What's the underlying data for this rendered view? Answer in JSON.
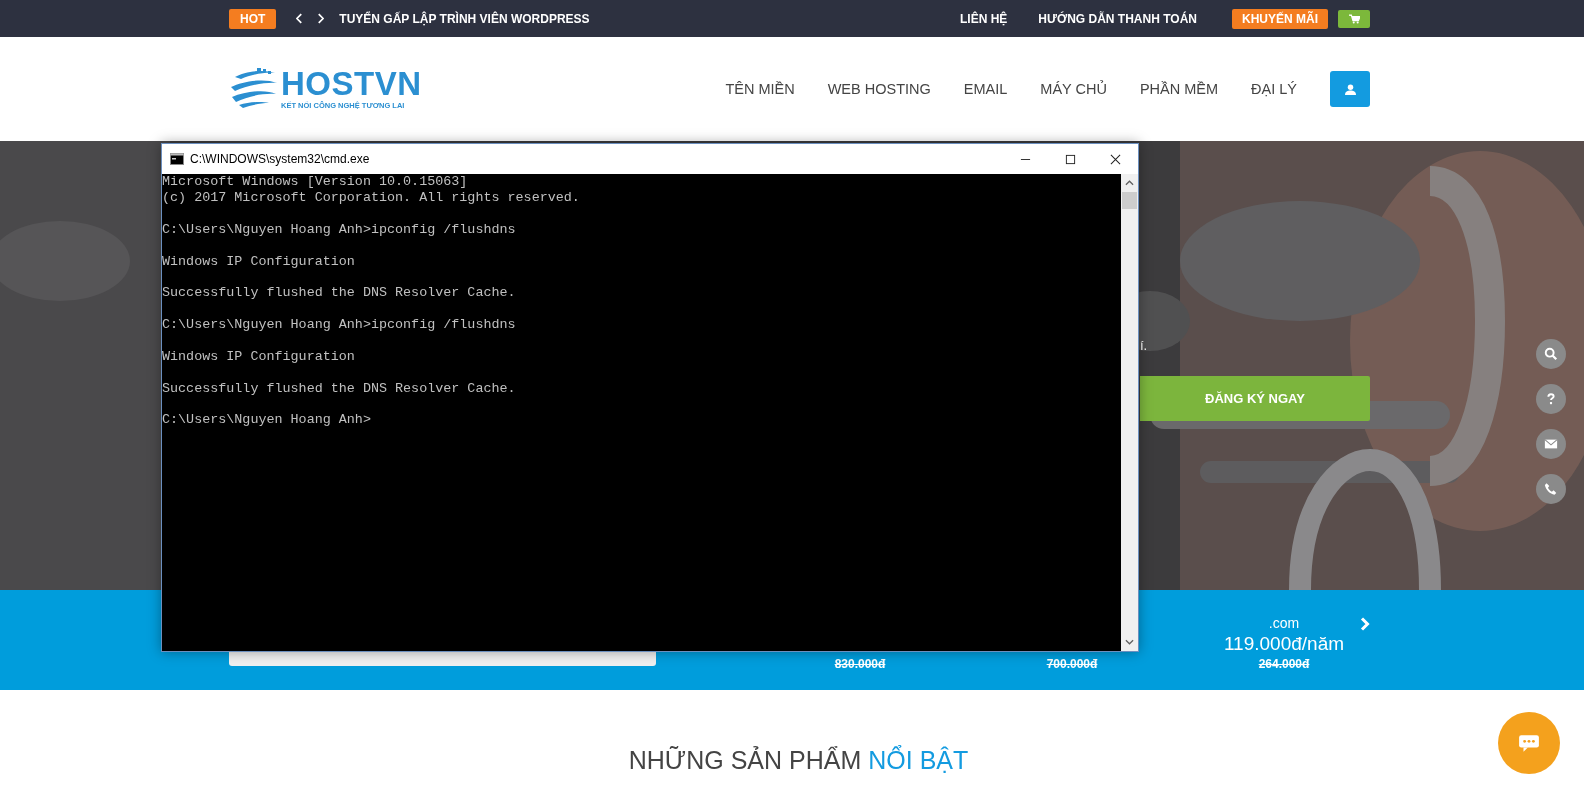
{
  "top_bar": {
    "badge": "HOT",
    "headline": "TUYỂN GẤP LẬP TRÌNH VIÊN WORDPRESS",
    "links": [
      "LIÊN HỆ",
      "HƯỚNG DẪN THANH TOÁN"
    ],
    "promo_button": "KHUYẾN MÃI"
  },
  "header": {
    "logo": {
      "name": "HOSTVN",
      "tagline": "KẾT NỐI CÔNG NGHỆ TƯƠNG LAI"
    },
    "nav": [
      "TÊN MIỀN",
      "WEB HOSTING",
      "EMAIL",
      "MÁY CHỦ",
      "PHẦN MỀM",
      "ĐẠI LÝ"
    ]
  },
  "hero": {
    "text": "í.",
    "button": "ĐĂNG KÝ NGAY"
  },
  "domain_band": {
    "prices": [
      {
        "old_price": "830.000đ"
      },
      {
        "old_price": "700.000đ"
      },
      {
        "extension": ".com",
        "price": "119.000đ/năm",
        "old_price": "264.000đ"
      }
    ]
  },
  "section": {
    "title": "NHỮNG SẢN PHẨM",
    "highlight": "NỔI BẬT"
  },
  "console_window": {
    "title": "C:\\WINDOWS\\system32\\cmd.exe",
    "blocks": [
      [
        "Microsoft Windows [Version 10.0.15063]",
        "(c) 2017 Microsoft Corporation. All rights reserved."
      ],
      [
        "C:\\Users\\Nguyen Hoang Anh>ipconfig /flushdns"
      ],
      [
        "Windows IP Configuration"
      ],
      [
        "Successfully flushed the DNS Resolver Cache."
      ],
      [
        "C:\\Users\\Nguyen Hoang Anh>ipconfig /flushdns"
      ],
      [
        "Windows IP Configuration"
      ],
      [
        "Successfully flushed the DNS Resolver Cache."
      ],
      [
        "C:\\Users\\Nguyen Hoang Anh>"
      ]
    ]
  }
}
